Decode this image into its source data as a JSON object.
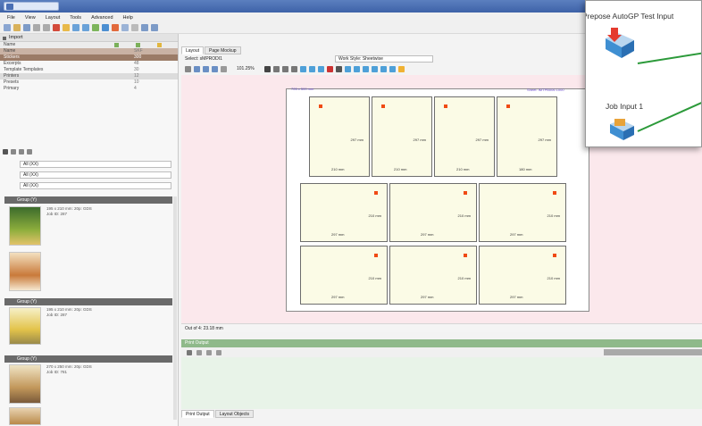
{
  "menu": [
    "File",
    "View",
    "Layout",
    "Tools",
    "Advanced",
    "Help"
  ],
  "left_panel": {
    "header": "Import",
    "columns": [
      "Name"
    ],
    "rows": [
      {
        "label": "Name",
        "value": "SKF"
      },
      {
        "label": "Stickers",
        "value": "300"
      },
      {
        "label": "Excerpts",
        "value": "48"
      },
      {
        "label": "Template Templates",
        "value": "30"
      },
      {
        "label": "Printers",
        "value": "12"
      },
      {
        "label": "Presets",
        "value": "10"
      },
      {
        "label": "Primary",
        "value": "4"
      }
    ],
    "dropdowns": [
      "All (XX)",
      "All (XX)",
      "All (XX)"
    ],
    "groups": [
      {
        "title": "Group (Y)",
        "line1": "195 x 210 mm: 20p: GDS",
        "line2": "Job ID: 287"
      },
      {
        "title": "Group (Y)",
        "line1": "195 x 210 mm: 20p: GDS",
        "line2": "Job ID: 287"
      },
      {
        "title": "Group (Y)",
        "line1": "270 x 250 mm: 20p: GDS",
        "line2": "Job ID: 781"
      }
    ]
  },
  "center": {
    "tabs": [
      "Layout",
      "Page Mockup"
    ],
    "select_label": "Select: sMPRODI1",
    "mode_label": "Work Style: Sheetwise",
    "zoom": "101.25%",
    "sheet_dims": "705 x 500 mm",
    "status": "Out of 4: 23.18 mm",
    "sheet_note": "Sheet: IMTPB006 1000",
    "cards_row1": [
      {
        "h": "297 mm",
        "w": "210 mm"
      },
      {
        "h": "297 mm",
        "w": "210 mm"
      },
      {
        "h": "297 mm",
        "w": "210 mm"
      },
      {
        "h": "297 mm",
        "w": "180 mm"
      }
    ],
    "cards_row2": [
      {
        "h": "210 mm",
        "w": "297 mm"
      },
      {
        "h": "210 mm",
        "w": "297 mm"
      },
      {
        "h": "210 mm",
        "w": "297 mm"
      }
    ],
    "cards_row3": [
      {
        "h": "210 mm",
        "w": "297 mm"
      },
      {
        "h": "210 mm",
        "w": "297 mm"
      },
      {
        "h": "210 mm",
        "w": "297 mm"
      }
    ]
  },
  "bottom": {
    "header": "Print Output",
    "tabs": [
      "Print Output",
      "Layout Objects"
    ]
  },
  "workflow": {
    "label1": "Prepose AutoGP Test Input",
    "label2": "Job Input 1"
  }
}
